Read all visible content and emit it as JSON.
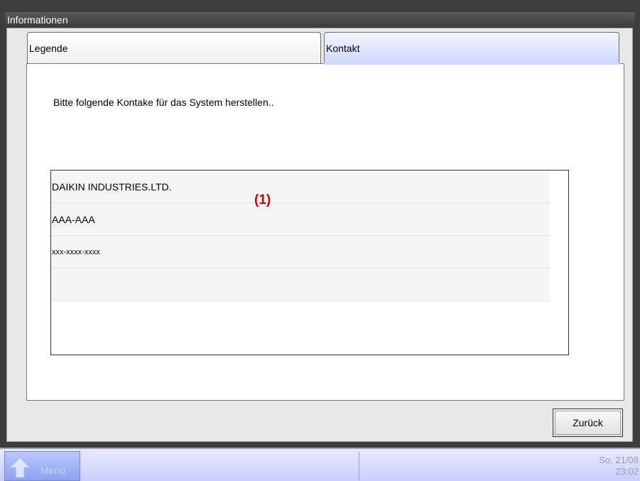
{
  "window": {
    "title": "Informationen"
  },
  "tabs": [
    {
      "label": "Legende",
      "active": false
    },
    {
      "label": "Kontakt",
      "active": true
    }
  ],
  "main": {
    "instruction": "Bitte folgende Kontake für das System herstellen..",
    "contact_rows": [
      "DAIKIN INDUSTRIES.LTD.",
      "AAA-AAA",
      "xxx-xxxx-xxxx",
      ""
    ],
    "callout": "(1)"
  },
  "buttons": {
    "back_label": "Zurück"
  },
  "footer": {
    "menu_label": "Menü",
    "date": "So, 21/08",
    "time": "23:02"
  },
  "colors": {
    "tab_active": "#cfd8ff",
    "callout": "#cc0000",
    "footer_bg": "#dde1ff"
  }
}
